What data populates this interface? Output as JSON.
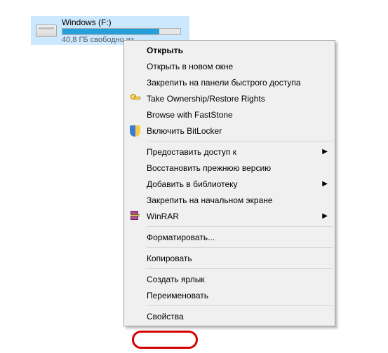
{
  "drive": {
    "name": "Windows (F:)",
    "free_text": "40,8 ГБ свободно из ...",
    "used_percent": 82
  },
  "menu": {
    "open": "Открыть",
    "open_new_window": "Открыть в новом окне",
    "pin_quick_access": "Закрепить на панели быстрого доступа",
    "take_ownership": "Take Ownership/Restore Rights",
    "browse_faststone": "Browse with FastStone",
    "bitlocker": "Включить BitLocker",
    "grant_access": "Предоставить доступ к",
    "restore_previous": "Восстановить прежнюю версию",
    "add_to_library": "Добавить в библиотеку",
    "pin_start": "Закрепить на начальном экране",
    "winrar": "WinRAR",
    "format": "Форматировать...",
    "copy": "Копировать",
    "create_shortcut": "Создать ярлык",
    "rename": "Переименовать",
    "properties": "Свойства"
  }
}
